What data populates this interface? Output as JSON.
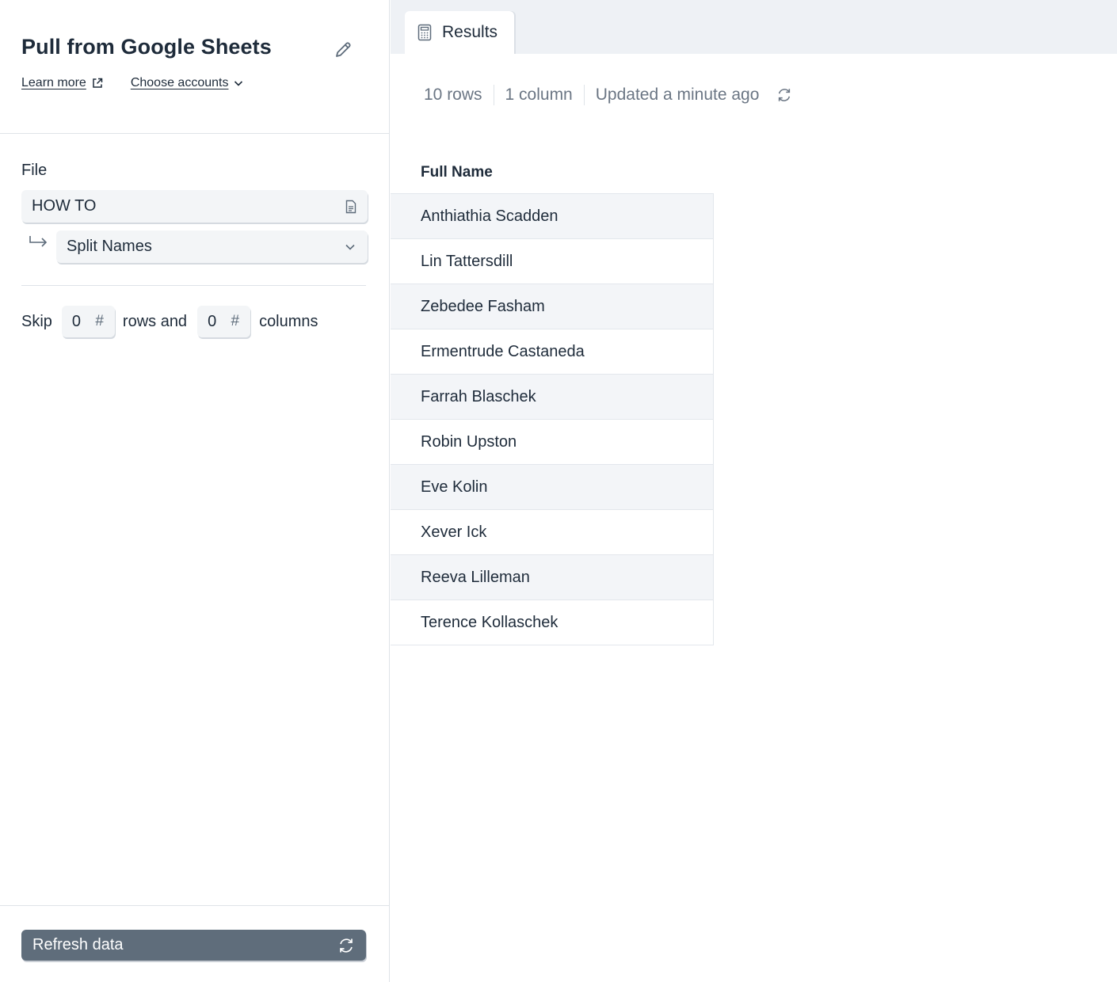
{
  "header": {
    "title": "Pull from Google Sheets",
    "learn_more": "Learn more",
    "choose_accounts": "Choose accounts"
  },
  "form": {
    "file_label": "File",
    "file_value": "HOW TO",
    "sheet_value": "Split Names",
    "skip_label": "Skip",
    "skip_rows_value": "0",
    "rows_and_label": "rows and",
    "skip_columns_value": "0",
    "columns_label": "columns",
    "hash_symbol": "#"
  },
  "footer": {
    "refresh_label": "Refresh data"
  },
  "results": {
    "tab_label": "Results",
    "row_count": "10 rows",
    "column_count": "1 column",
    "updated": "Updated a minute ago",
    "column_header": "Full Name",
    "rows": [
      "Anthiathia Scadden",
      "Lin Tattersdill",
      "Zebedee Fasham",
      "Ermentrude Castaneda",
      "Farrah Blaschek",
      "Robin Upston",
      "Eve Kolin",
      "Xever Ick",
      "Reeva Lilleman",
      "Terence Kollaschek"
    ]
  },
  "icons": {
    "edit": "pencil-icon",
    "external_link": "external-link-icon",
    "dropdown": "chevron-down-icon",
    "file": "document-icon",
    "nested": "corner-arrow-icon",
    "refresh": "refresh-icon",
    "results_tab": "calculator-icon"
  },
  "colors": {
    "refresh_button": "#5f6d7b",
    "row_stripe": "#f3f5f8",
    "tabbar_bg": "#eef1f5"
  }
}
